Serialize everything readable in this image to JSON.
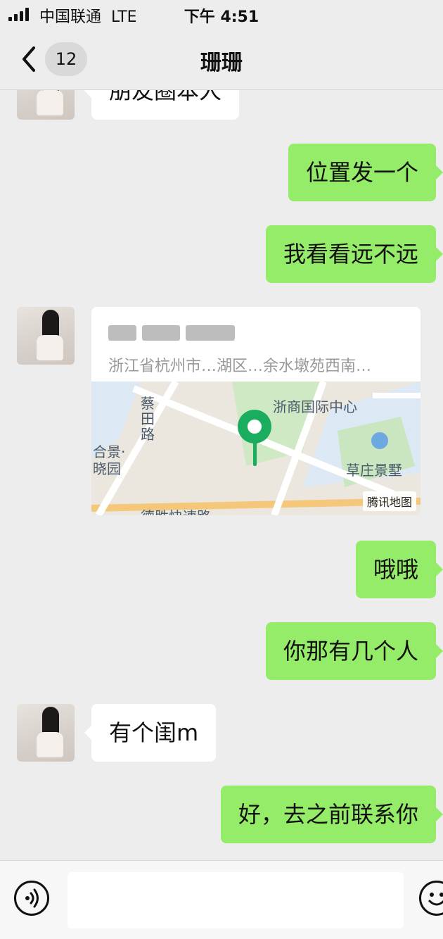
{
  "status": {
    "carrier": "中国联通",
    "network": "LTE",
    "time": "下午 4:51"
  },
  "nav": {
    "unread": "12",
    "title": "珊珊"
  },
  "messages": [
    {
      "side": "in",
      "text": "朋友圈本人"
    },
    {
      "side": "out",
      "text": "位置发一个"
    },
    {
      "side": "out",
      "text": "我看看远不远"
    },
    {
      "side": "out",
      "text": "哦哦"
    },
    {
      "side": "out",
      "text": "你那有几个人"
    },
    {
      "side": "in",
      "text": "有个闺m"
    },
    {
      "side": "out",
      "text": "好，去之前联系你"
    }
  ],
  "location": {
    "address": "浙江省杭州市…湖区…余水墩苑西南…",
    "map_labels": [
      "浙商国际中心",
      "草庄景墅",
      "合景·晓园",
      "蔡田路",
      "德胜快速路"
    ],
    "map_brand": "腾讯地图"
  }
}
